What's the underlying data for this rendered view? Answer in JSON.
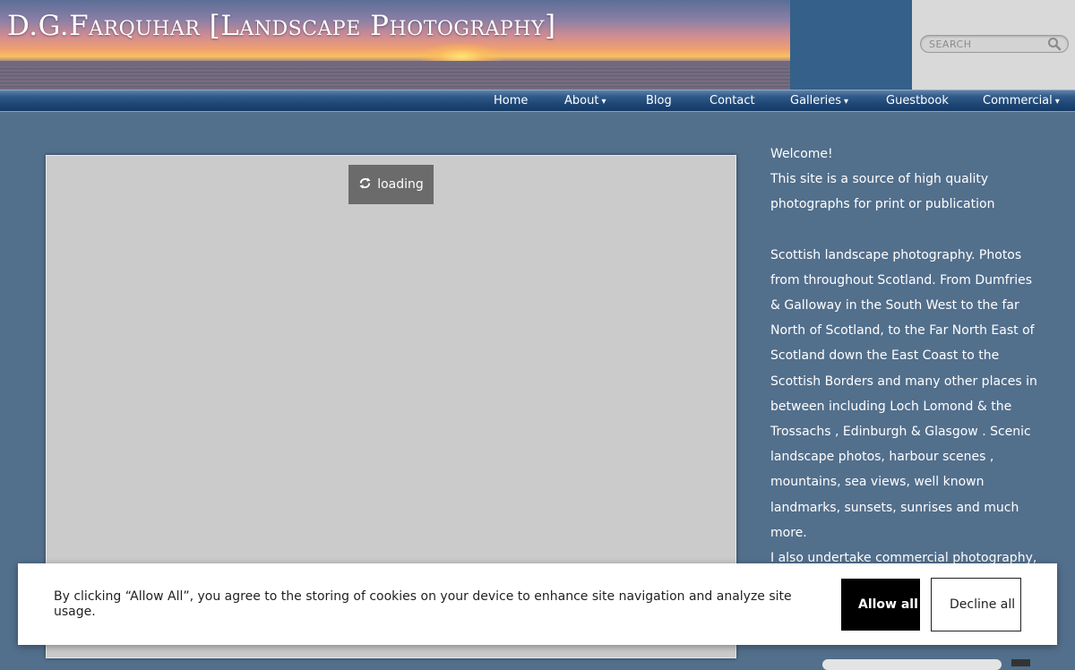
{
  "header": {
    "site_title": "D.G.Farquhar [Landscape Photography]",
    "search_placeholder": "SEARCH",
    "search_icon": "magnifier-icon"
  },
  "nav": {
    "items": [
      {
        "label": "Home",
        "has_dropdown": false
      },
      {
        "label": "About",
        "has_dropdown": true
      },
      {
        "label": "Blog",
        "has_dropdown": false
      },
      {
        "label": "Contact",
        "has_dropdown": false
      },
      {
        "label": "Galleries",
        "has_dropdown": true
      },
      {
        "label": "Guestbook",
        "has_dropdown": false
      },
      {
        "label": "Commercial",
        "has_dropdown": true
      }
    ],
    "dropdown_glyph": "▾"
  },
  "slideshow": {
    "loading_label": "loading",
    "loading_icon": "refresh-icon"
  },
  "sidebar": {
    "welcome": "Welcome!",
    "intro": "This site is a source of high quality photographs for print or publication",
    "description": "Scottish landscape photography. Photos from throughout Scotland. From Dumfries & Galloway in the South West to the far North of Scotland, to the Far North East of Scotland down the East Coast to the Scottish Borders and many other places in between including Loch Lomond & the Trossachs , Edinburgh & Glasgow . Scenic landscape photos, harbour scenes , mountains, sea views, well known landmarks, sunsets, sunrises and much more.",
    "commercial": "I also undertake commercial photography,"
  },
  "cookie_banner": {
    "message": "By clicking “Allow All”, you agree to the storing of cookies on your device to enhance site navigation and analyze site usage.",
    "allow_label": "Allow all",
    "decline_label": "Decline all"
  },
  "colors": {
    "page_background": "#526f8c",
    "nav_background": "#1d4574",
    "header_accent": "#34608a",
    "slideshow_background": "#cbcbcb",
    "allow_button": "#000000"
  }
}
